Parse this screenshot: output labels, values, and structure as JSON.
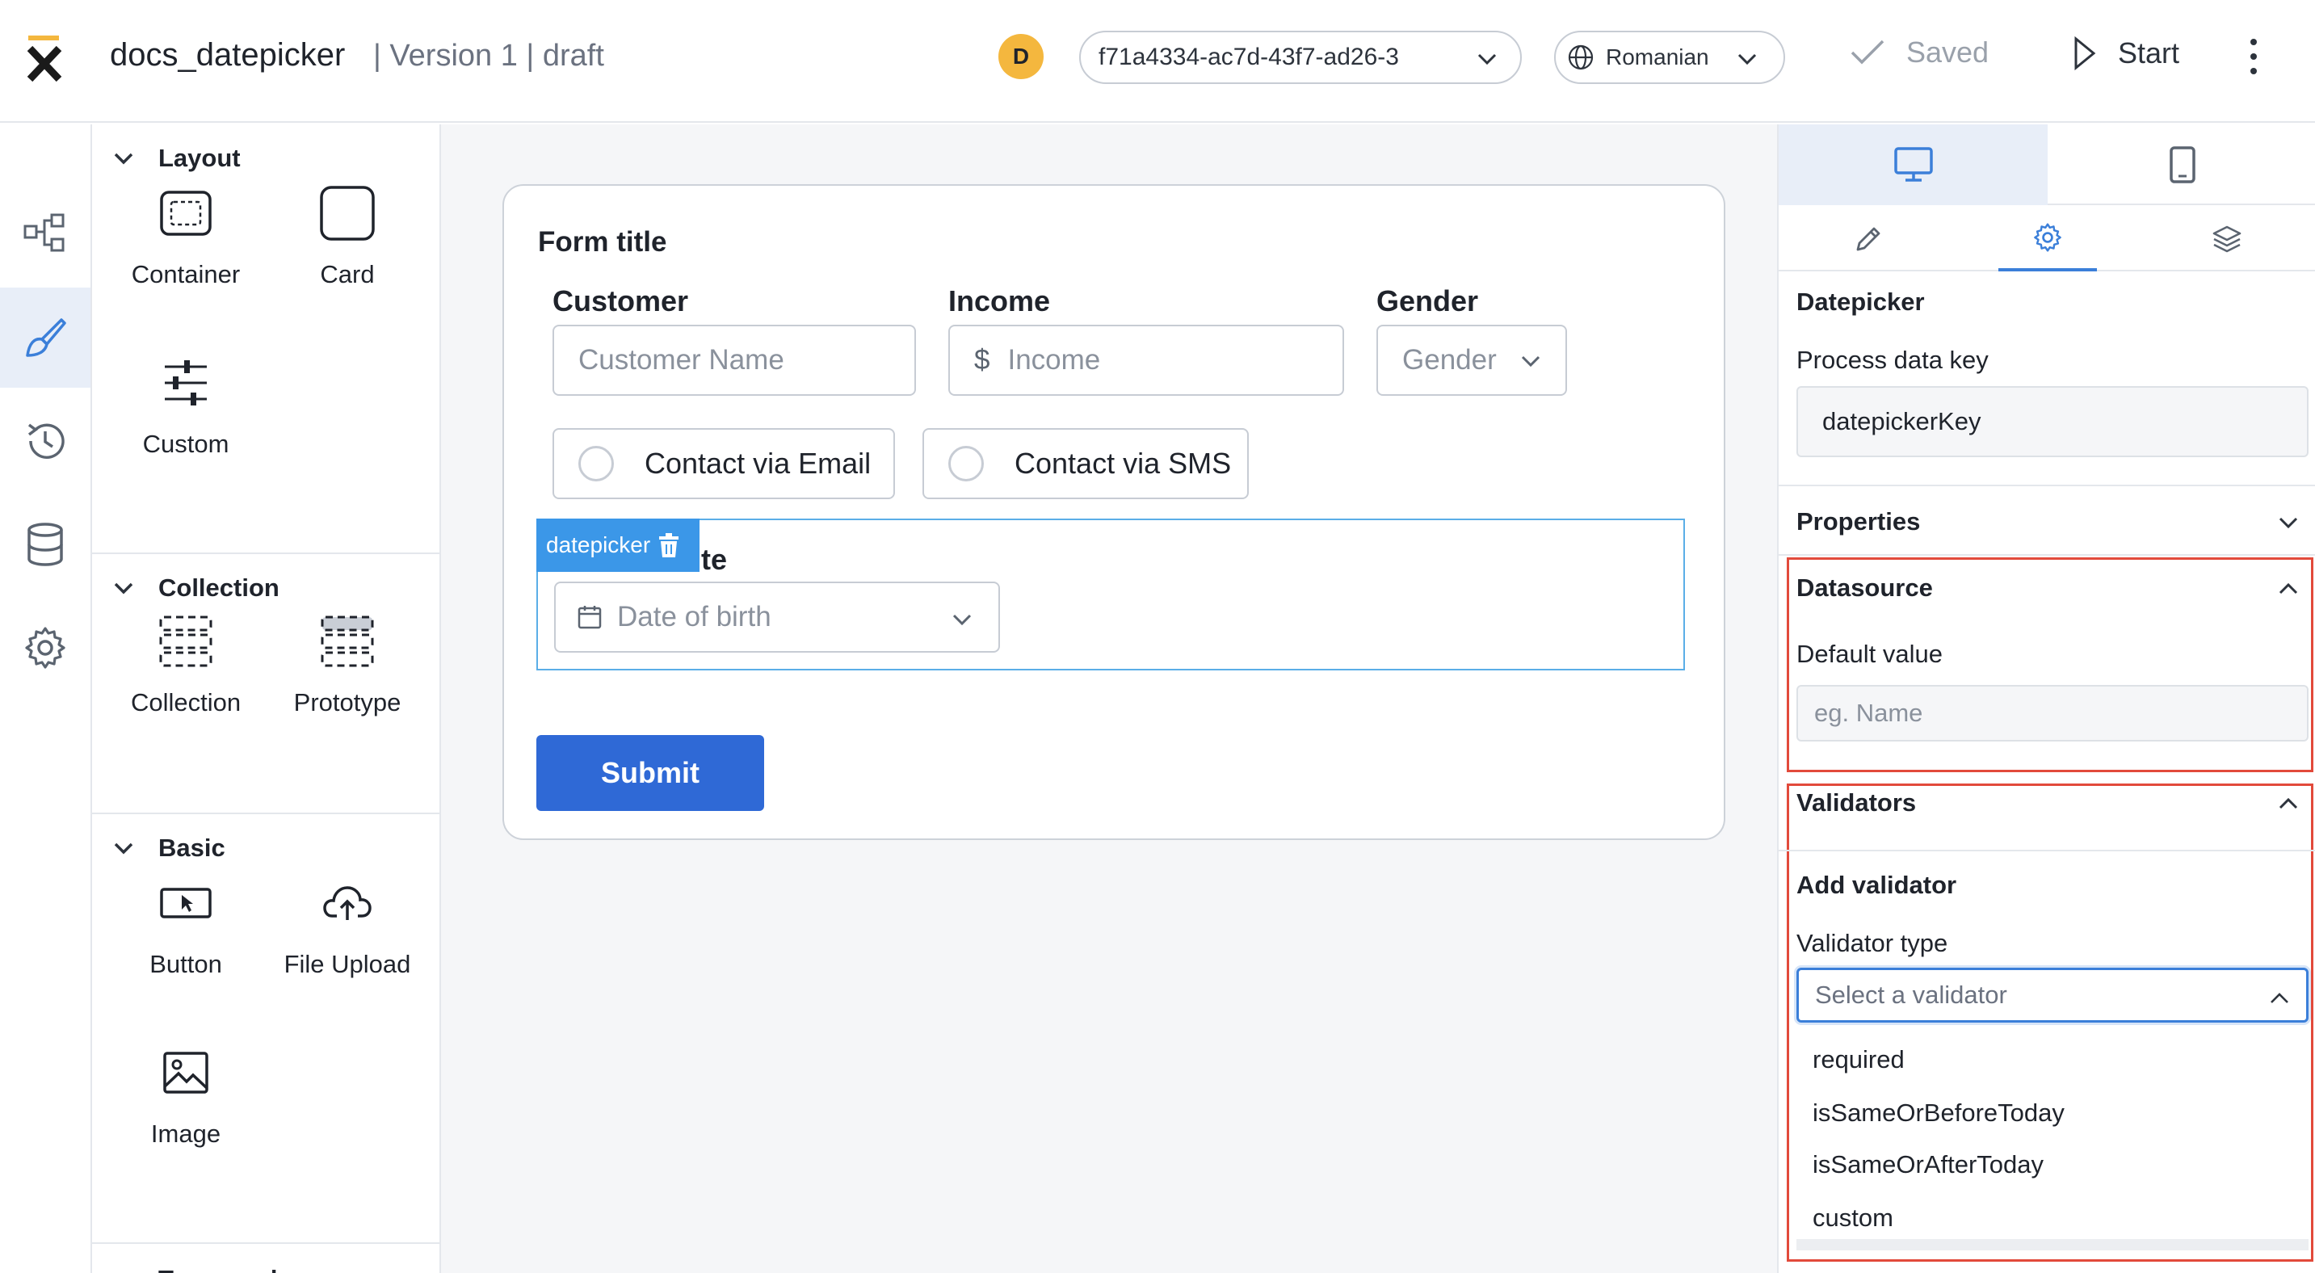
{
  "header": {
    "doc_title": "docs_datepicker",
    "doc_meta": "| Version 1 | draft",
    "avatar_initial": "D",
    "version_value": "f71a4334-ac7d-43f7-ad26-3",
    "language": "Romanian",
    "saved_label": "Saved",
    "start_label": "Start"
  },
  "palette": {
    "layout_title": "Layout",
    "collection_title": "Collection",
    "basic_title": "Basic",
    "typography_title": "Typography",
    "items": {
      "container": "Container",
      "card": "Card",
      "custom": "Custom",
      "collection": "Collection",
      "prototype": "Prototype",
      "button": "Button",
      "file_upload": "File Upload",
      "image": "Image"
    }
  },
  "form": {
    "title": "Form title",
    "customer_label": "Customer",
    "customer_placeholder": "Customer Name",
    "income_label": "Income",
    "income_prefix": "$",
    "income_placeholder": "Income",
    "gender_label": "Gender",
    "gender_placeholder": "Gender",
    "contact_email": "Contact via Email",
    "contact_sms": "Contact via SMS",
    "datepicker_tag": "datepicker",
    "datepicker_label_tail": "te",
    "datepicker_placeholder": "Date of birth",
    "submit_label": "Submit"
  },
  "properties": {
    "component_title": "Datepicker",
    "process_key_label": "Process data key",
    "process_key_value": "datepickerKey",
    "properties_title": "Properties",
    "datasource_title": "Datasource",
    "default_value_label": "Default value",
    "default_value_placeholder": "eg. Name",
    "validators_title": "Validators",
    "add_validator_title": "Add validator",
    "validator_type_label": "Validator type",
    "validator_placeholder": "Select a validator",
    "validator_options": [
      "required",
      "isSameOrBeforeToday",
      "isSameOrAfterToday",
      "custom"
    ]
  },
  "colors": {
    "accent": "#3b7fd9",
    "submit": "#2f69d6",
    "highlight_frame": "#e24a3b",
    "avatar": "#f4b73e",
    "datepicker_tag": "#3b97e8"
  },
  "icons": {
    "rail": [
      "process-flow-icon",
      "brush-icon",
      "history-icon",
      "database-icon",
      "gear-icon"
    ]
  }
}
